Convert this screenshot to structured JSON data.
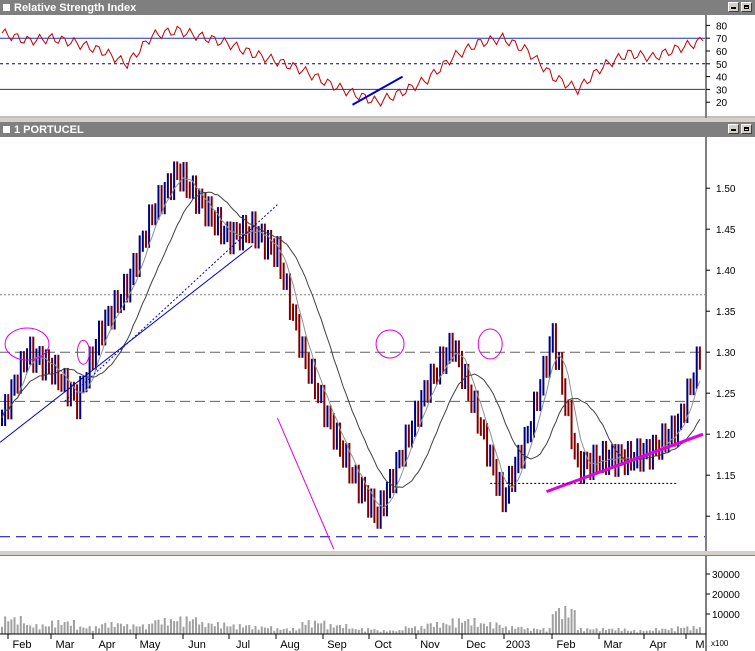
{
  "window": {
    "rsi_title": "Relative Strength Index",
    "price_title": "1 PORTUCEL"
  },
  "axes": {
    "rsi_ticks": [
      "80",
      "70",
      "60",
      "50",
      "40",
      "30",
      "20"
    ],
    "price_ticks": [
      "1.50",
      "1.45",
      "1.40",
      "1.35",
      "1.30",
      "1.25",
      "1.20",
      "1.15",
      "1.10"
    ],
    "volume_ticks": [
      "30000",
      "20000",
      "10000"
    ],
    "volume_unit": "x100",
    "months": [
      "Feb",
      "Mar",
      "Apr",
      "May",
      "Jun",
      "Jul",
      "Aug",
      "Sep",
      "Oct",
      "Nov",
      "Dec",
      "2003",
      "Feb",
      "Mar",
      "Apr",
      "M"
    ]
  },
  "colors": {
    "up_bar": "#000080",
    "down_bar": "#800000",
    "rsi_line": "#c00000",
    "trend_blue": "#0000cc",
    "trend_magenta": "#e000e0",
    "volume_bar": "#a0a0a0"
  },
  "chart_data": [
    {
      "type": "line",
      "name": "rsi",
      "ylim": [
        10,
        85
      ],
      "reference_levels": [
        70,
        50,
        30
      ],
      "x": [
        0,
        4,
        8,
        12,
        16,
        20,
        24,
        28,
        32,
        36,
        40,
        44,
        48,
        52,
        56,
        60,
        64,
        68,
        72,
        76,
        80,
        84,
        88,
        92,
        96,
        100,
        104,
        108,
        112
      ],
      "values": [
        74,
        68,
        70,
        66,
        60,
        50,
        72,
        76,
        71,
        66,
        58,
        52,
        45,
        35,
        27,
        20,
        28,
        38,
        55,
        66,
        70,
        60,
        40,
        30,
        48,
        58,
        55,
        62,
        68
      ],
      "grid": true
    },
    {
      "type": "line",
      "name": "price",
      "ylim": [
        1.06,
        1.56
      ],
      "x": [
        0,
        4,
        8,
        12,
        16,
        20,
        24,
        28,
        32,
        36,
        40,
        44,
        48,
        52,
        56,
        60,
        64,
        68,
        72,
        76,
        80,
        84,
        88,
        92,
        96,
        100,
        104,
        108,
        112
      ],
      "values": [
        1.22,
        1.3,
        1.28,
        1.24,
        1.33,
        1.38,
        1.47,
        1.52,
        1.48,
        1.44,
        1.45,
        1.42,
        1.3,
        1.22,
        1.15,
        1.1,
        1.18,
        1.26,
        1.31,
        1.22,
        1.12,
        1.2,
        1.32,
        1.16,
        1.17,
        1.17,
        1.18,
        1.21,
        1.31
      ],
      "grid": true
    },
    {
      "type": "bar",
      "name": "volume",
      "ylim": [
        0,
        36000
      ],
      "x": [
        0,
        4,
        8,
        12,
        16,
        20,
        24,
        28,
        32,
        36,
        40,
        44,
        48,
        52,
        56,
        60,
        64,
        68,
        72,
        76,
        80,
        84,
        88,
        92,
        96,
        100,
        104,
        108,
        112
      ],
      "values": [
        9000,
        5000,
        7000,
        4000,
        6000,
        5000,
        8000,
        9000,
        6000,
        5000,
        4000,
        3000,
        7000,
        5000,
        3000,
        2000,
        4000,
        6000,
        8000,
        6000,
        4000,
        3000,
        14000,
        3000,
        3000,
        2000,
        3000,
        4000,
        20000
      ]
    }
  ]
}
